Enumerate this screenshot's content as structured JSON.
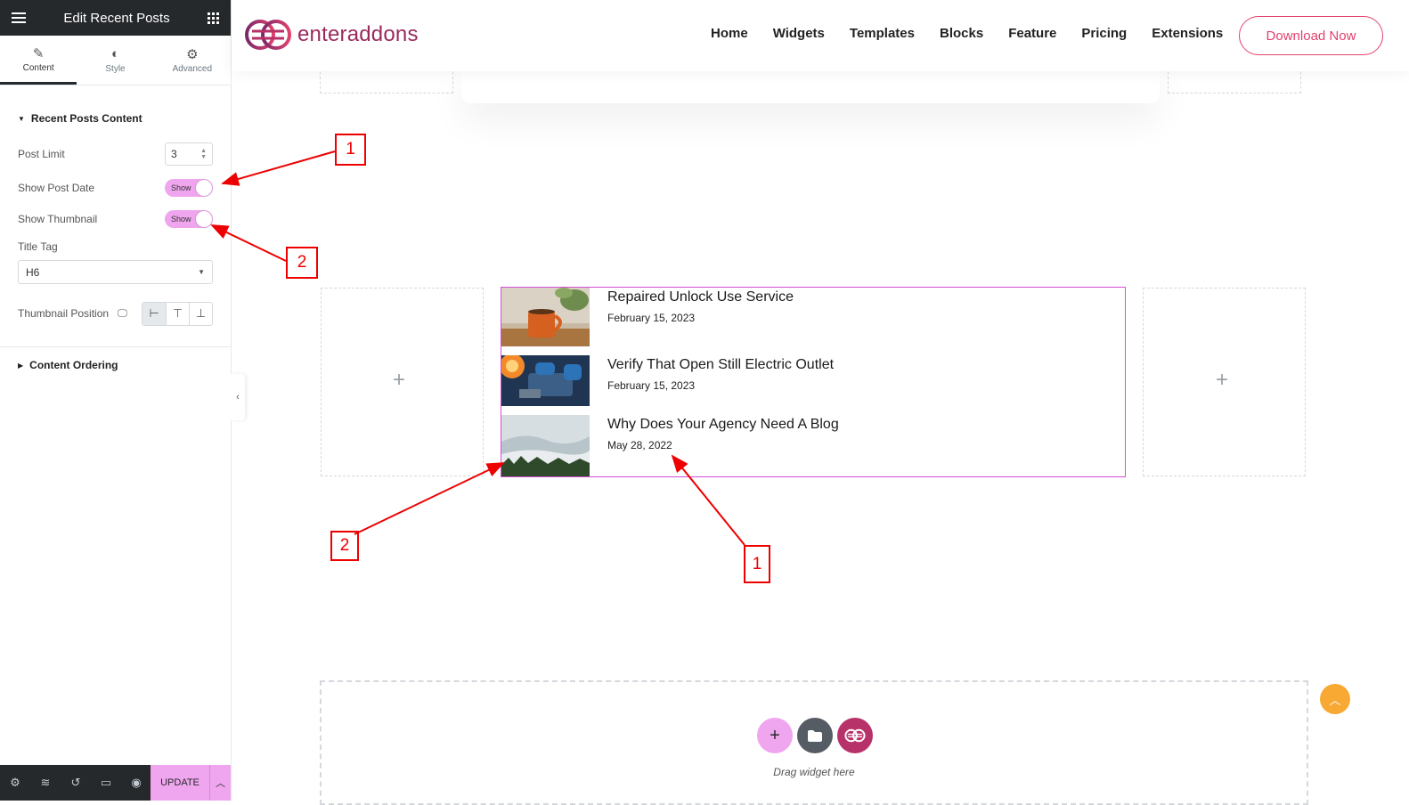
{
  "panel": {
    "title": "Edit Recent Posts",
    "tabs": [
      {
        "label": "Content",
        "icon": "pencil-icon"
      },
      {
        "label": "Style",
        "icon": "contrast-icon"
      },
      {
        "label": "Advanced",
        "icon": "gear-icon"
      }
    ],
    "section_recent": "Recent Posts Content",
    "post_limit_label": "Post Limit",
    "post_limit_value": "3",
    "show_post_date_label": "Show Post Date",
    "show_post_date_value": "Show",
    "show_thumbnail_label": "Show Thumbnail",
    "show_thumbnail_value": "Show",
    "title_tag_label": "Title Tag",
    "title_tag_value": "H6",
    "thumbnail_position_label": "Thumbnail Position",
    "section_ordering": "Content Ordering",
    "update_label": "UPDATE",
    "accent": "#f0a6ef"
  },
  "header": {
    "logo_text": "enteraddons",
    "nav": [
      "Home",
      "Widgets",
      "Templates",
      "Blocks",
      "Feature",
      "Pricing",
      "Extensions"
    ],
    "cta": "Download Now",
    "brand_color": "#e2416d"
  },
  "posts": [
    {
      "title": "Repaired Unlock Use Service",
      "date": "February 15, 2023"
    },
    {
      "title": "Verify That Open Still Electric Outlet",
      "date": "February 15, 2023"
    },
    {
      "title": "Why Does Your Agency Need A Blog",
      "date": "May 28, 2022"
    }
  ],
  "annotations": {
    "a1": "1",
    "a2": "2",
    "a3": "2",
    "a4": "1"
  },
  "canvas": {
    "plus": "+",
    "drop_text": "Drag widget here"
  }
}
